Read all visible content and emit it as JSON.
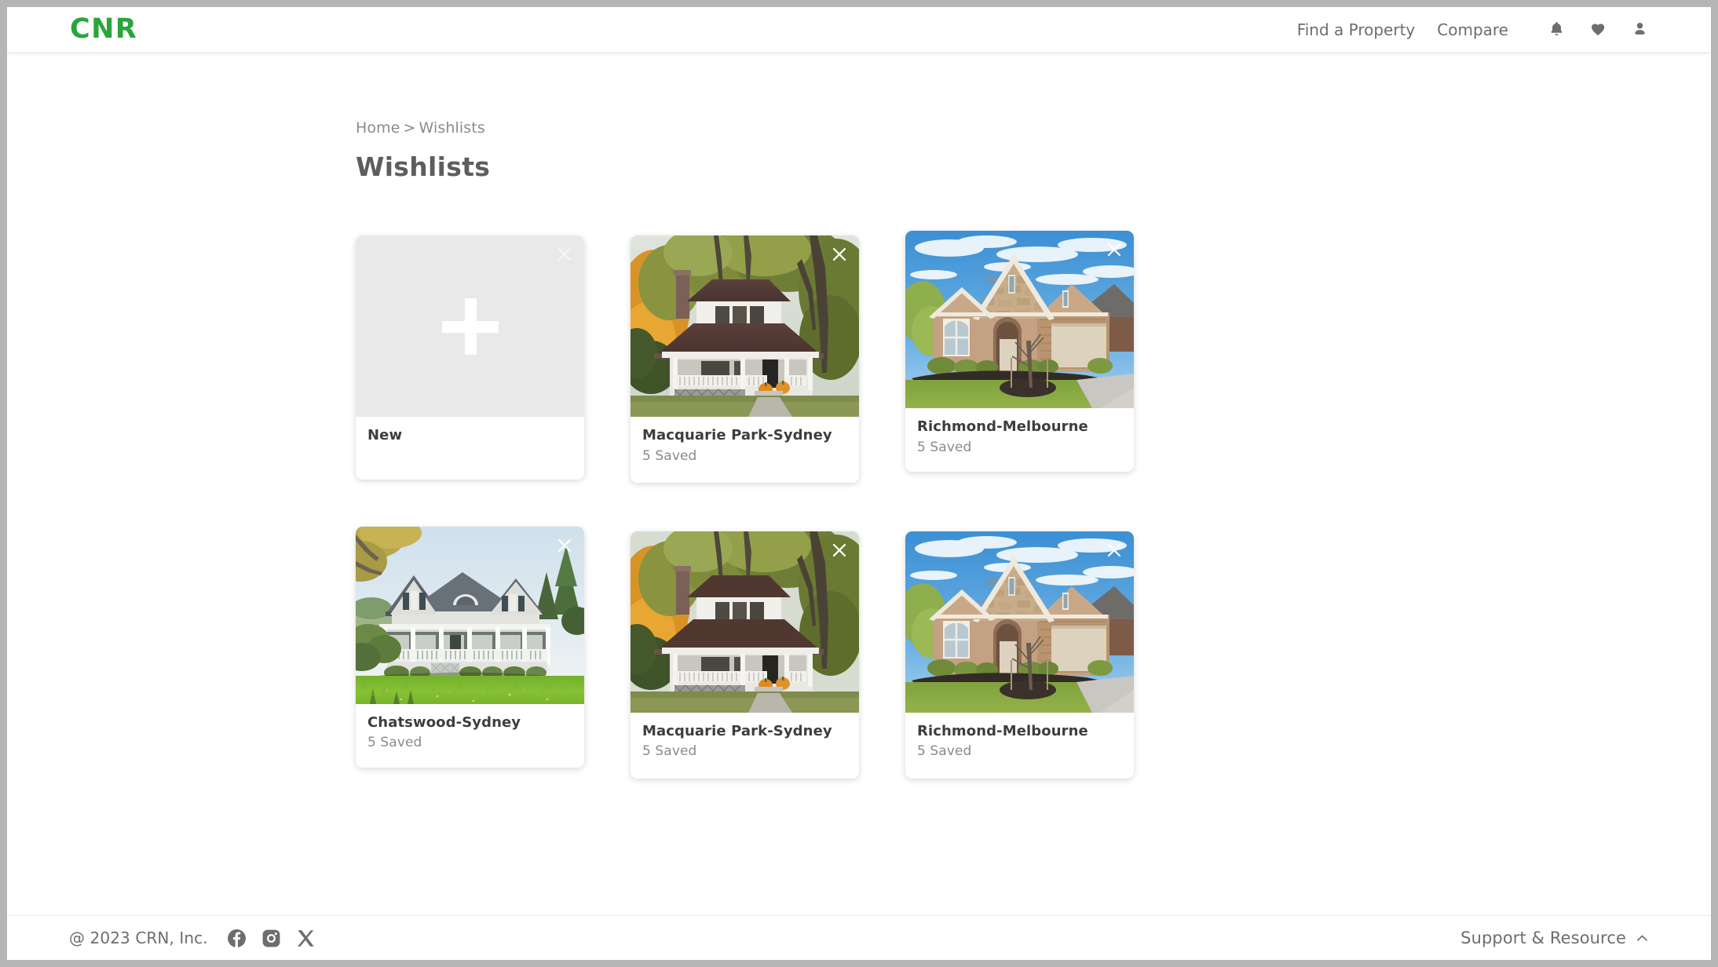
{
  "header": {
    "brand": "CNR",
    "nav": [
      {
        "label": "Find a Property",
        "name": "nav-find-a-property"
      },
      {
        "label": "Compare",
        "name": "nav-compare"
      }
    ],
    "icons": [
      {
        "name": "bell-icon",
        "label": "Notifications"
      },
      {
        "name": "heart-icon",
        "label": "Saved"
      },
      {
        "name": "person-icon",
        "label": "Account"
      }
    ]
  },
  "breadcrumb": {
    "home": "Home",
    "separator": ">",
    "current": "Wishlists"
  },
  "page": {
    "title": "Wishlists"
  },
  "cards": [
    {
      "kind": "new",
      "title": "New",
      "subtitle": "",
      "icon": "plus-icon",
      "close_icon": "close-icon",
      "thumb": "placeholder"
    },
    {
      "kind": "wishlist",
      "title": "Macquarie Park-Sydney",
      "subtitle": "5 Saved",
      "close_icon": "close-icon",
      "thumb": "white-craftsman-house-autumn"
    },
    {
      "kind": "wishlist",
      "title": "Richmond-Melbourne",
      "subtitle": "5 Saved",
      "close_icon": "close-icon",
      "thumb": "stone-brick-house-blue-sky"
    },
    {
      "kind": "wishlist",
      "title": "Chatswood-Sydney",
      "subtitle": "5 Saved",
      "close_icon": "close-icon",
      "thumb": "white-farmhouse-wrap-porch"
    },
    {
      "kind": "wishlist",
      "title": "Macquarie Park-Sydney",
      "subtitle": "5 Saved",
      "close_icon": "close-icon",
      "thumb": "white-craftsman-house-autumn"
    },
    {
      "kind": "wishlist",
      "title": "Richmond-Melbourne",
      "subtitle": "5 Saved",
      "close_icon": "close-icon",
      "thumb": "stone-brick-house-blue-sky"
    }
  ],
  "footer": {
    "copyright": "@ 2023 CRN, Inc.",
    "social": [
      {
        "name": "facebook-icon",
        "label": "Facebook"
      },
      {
        "name": "instagram-icon",
        "label": "Instagram"
      },
      {
        "name": "x-icon",
        "label": "X"
      }
    ],
    "support_label": "Support & Resource",
    "support_chevron": "chevron-up-icon"
  },
  "colors": {
    "brand_green": "#2aa53a",
    "text_gray": "#6d6d6d",
    "title_gray": "#5d5d5d",
    "muted_gray": "#8a8a8a",
    "placeholder_gray": "#e9e9e9",
    "frame_gray": "#b5b5b5"
  }
}
